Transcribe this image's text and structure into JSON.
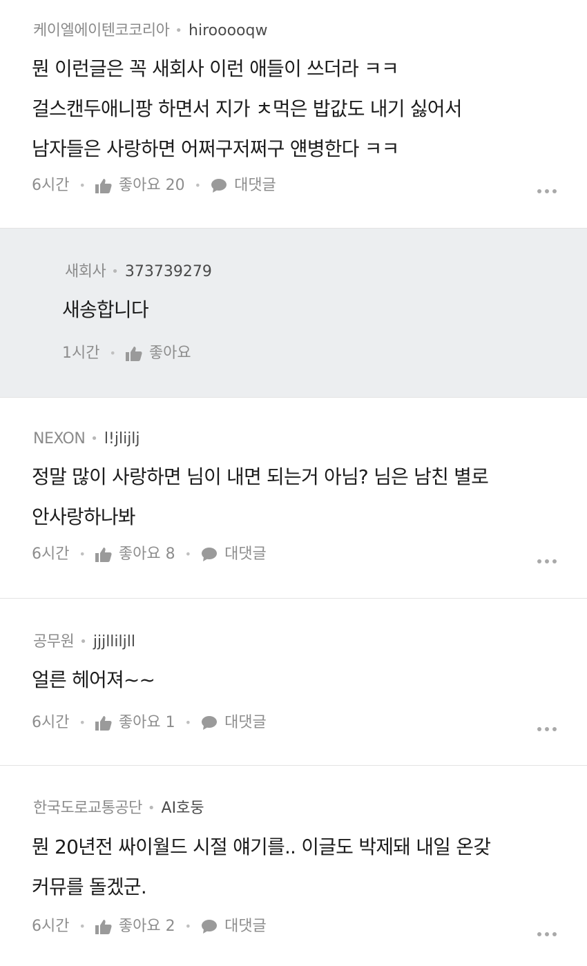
{
  "comments": [
    {
      "company": "케이엘에이텐코코리아",
      "user": "hirooooqw",
      "lines": [
        "뭔 이런글은 꼭 새회사 이런 애들이 쓰더라 ㅋㅋ",
        "걸스캔두애니팡 하면서 지가 ㅊ먹은 밥값도 내기 싫어서",
        "남자들은 사랑하면 어쩌구저쩌구 얜병한다 ㅋㅋ"
      ],
      "time": "6시간",
      "like_label": "좋아요 20",
      "reply_label": "대댓글"
    },
    {
      "company": "새회사",
      "user": "373739279",
      "lines": [
        "새송합니다"
      ],
      "time": "1시간",
      "like_label": "좋아요"
    },
    {
      "company": "NEXON",
      "user": "l!jlijlj",
      "lines": [
        "정말 많이 사랑하면 님이 내면 되는거 아님? 님은 남친 별로",
        "안사랑하나봐"
      ],
      "time": "6시간",
      "like_label": "좋아요 8",
      "reply_label": "대댓글"
    },
    {
      "company": "공무원",
      "user": "jjjllilјll",
      "lines": [
        "얼른 헤어져~~"
      ],
      "time": "6시간",
      "like_label": "좋아요 1",
      "reply_label": "대댓글"
    },
    {
      "company": "한국도로교통공단",
      "user": "AI호둥",
      "lines": [
        "뭔 20년전 싸이월드 시절 얘기를.. 이글도 박제돼 내일 온갖",
        "커뮤를 돌겠군."
      ],
      "time": "6시간",
      "like_label": "좋아요 2",
      "reply_label": "대댓글"
    }
  ],
  "icons": {
    "like": "thumbs-up-icon",
    "reply": "speech-bubble-icon",
    "more": "more-dots-icon"
  },
  "colors": {
    "reply_background": "#eceef0",
    "meta_gray": "#8d8d8d",
    "text": "#1c1c1c"
  }
}
